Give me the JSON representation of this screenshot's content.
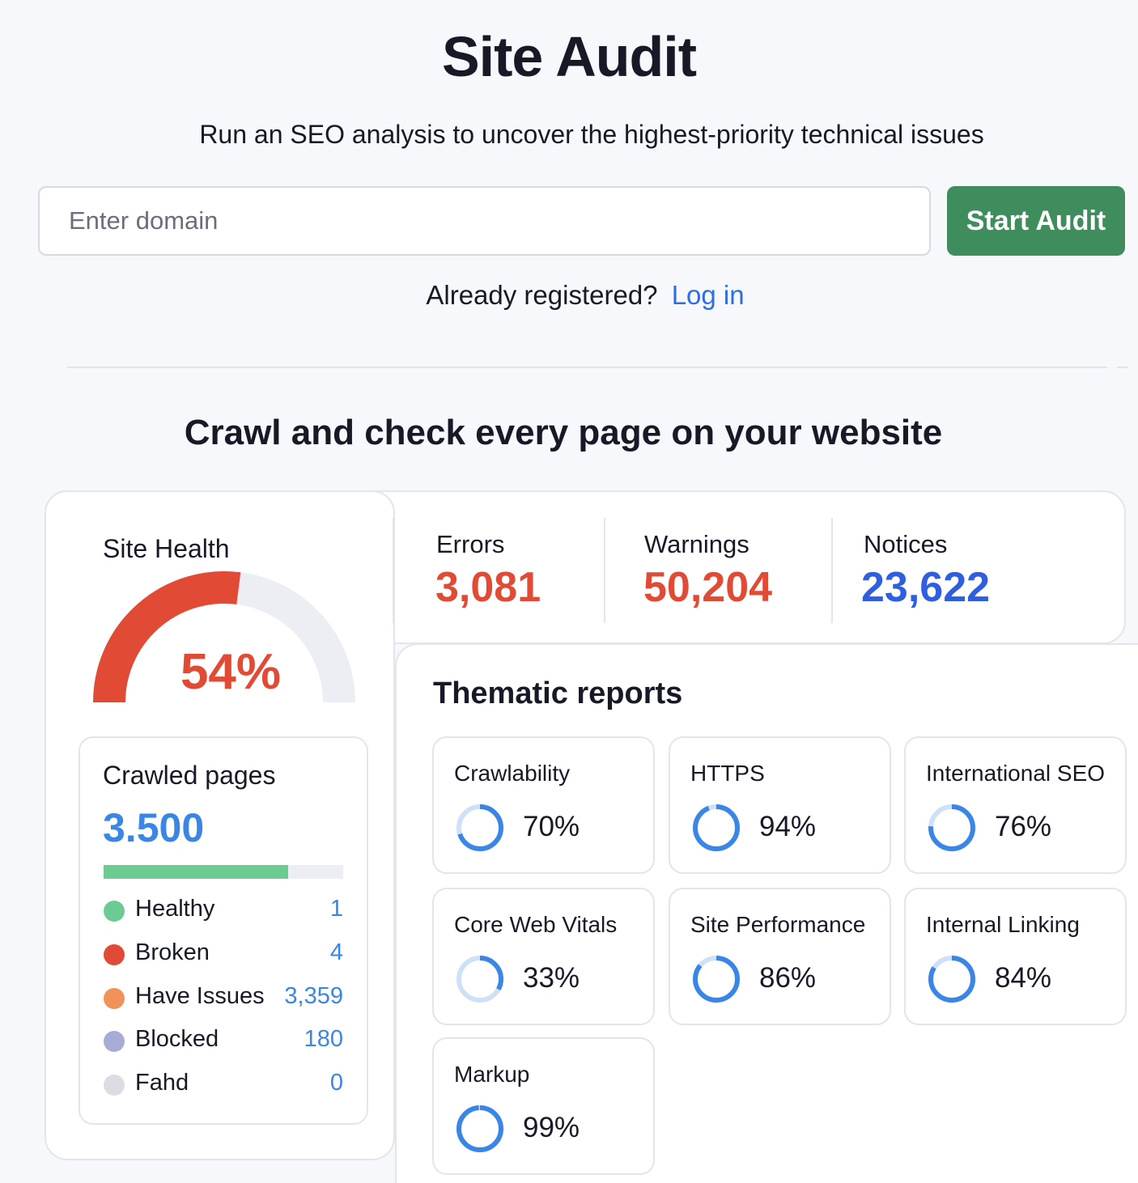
{
  "header": {
    "title": "Site Audit",
    "subtitle": "Run an SEO analysis to uncover the highest-priority technical issues"
  },
  "search": {
    "placeholder": "Enter domain",
    "value": "",
    "button_label": "Start Audit"
  },
  "login": {
    "prompt": "Already registered?",
    "link_label": "Log in"
  },
  "section": {
    "title": "Crawl and check every page on your website"
  },
  "colors": {
    "accent_green": "#3f8c5c",
    "link_blue": "#2e6ee0",
    "error_red": "#e14a35",
    "notice_blue": "#2f5ee0",
    "value_blue": "#3a86e6"
  },
  "site_health": {
    "label": "Site Health",
    "value_text": "54%",
    "value": 0.54
  },
  "stats": [
    {
      "label": "Errors",
      "value": "3,081",
      "color": "#e14a35"
    },
    {
      "label": "Warnings",
      "value": "50,204",
      "color": "#e14a35"
    },
    {
      "label": "Notices",
      "value": "23,622",
      "color": "#2f5ee0"
    }
  ],
  "crawled": {
    "title": "Crawled pages",
    "value": "3.500",
    "bar_fill": 0.77,
    "legend": [
      {
        "label": "Healthy",
        "count": "1",
        "color": "#6ccb93"
      },
      {
        "label": "Broken",
        "count": "4",
        "color": "#e14a35"
      },
      {
        "label": "Have Issues",
        "count": "3,359",
        "color": "#f0925a"
      },
      {
        "label": "Blocked",
        "count": "180",
        "color": "#a6acd6"
      },
      {
        "label": "Fahd",
        "count": "0",
        "color": "#dcdde2"
      }
    ]
  },
  "thematic": {
    "title": "Thematic reports",
    "reports": [
      {
        "name": "Crawlability",
        "percent": "70%",
        "value": 0.7
      },
      {
        "name": "HTTPS",
        "percent": "94%",
        "value": 0.94
      },
      {
        "name": "International SEO",
        "percent": "76%",
        "value": 0.76
      },
      {
        "name": "Core Web Vitals",
        "percent": "33%",
        "value": 0.33
      },
      {
        "name": "Site Performance",
        "percent": "86%",
        "value": 0.86
      },
      {
        "name": "Internal Linking",
        "percent": "84%",
        "value": 0.84
      },
      {
        "name": "Markup",
        "percent": "99%",
        "value": 0.99
      }
    ]
  }
}
